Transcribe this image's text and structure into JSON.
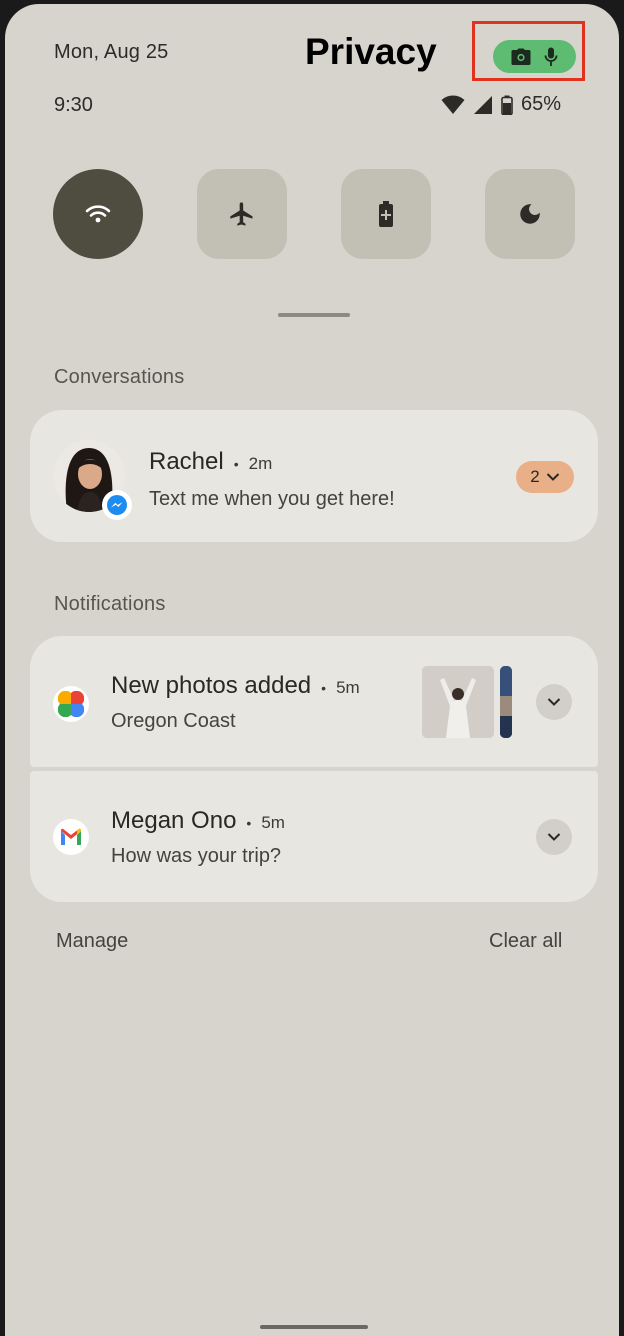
{
  "header": {
    "date": "Mon, Aug 25",
    "time": "9:30",
    "privacy_label": "Privacy",
    "battery_percent": "65%"
  },
  "privacy_indicator": {
    "icons": [
      "camera-icon",
      "microphone-icon"
    ],
    "chip_color": "#5dbb72",
    "highlight_color": "#e0321c"
  },
  "quick_settings": [
    {
      "icon": "wifi-icon",
      "active": true
    },
    {
      "icon": "airplane-icon",
      "active": false
    },
    {
      "icon": "battery-saver-icon",
      "active": false
    },
    {
      "icon": "moon-icon",
      "active": false
    }
  ],
  "conversations": {
    "heading": "Conversations",
    "items": [
      {
        "name": "Rachel",
        "ago": "2m",
        "message": "Text me when you get here!",
        "count": "2",
        "app_icon": "messenger-icon"
      }
    ]
  },
  "notifications": {
    "heading": "Notifications",
    "items": [
      {
        "title": "New photos added",
        "ago": "5m",
        "body": "Oregon Coast",
        "app_icon": "google-photos-icon"
      },
      {
        "title": "Megan Ono",
        "ago": "5m",
        "body": "How was your trip?",
        "app_icon": "gmail-icon"
      }
    ]
  },
  "footer": {
    "manage_label": "Manage",
    "clear_label": "Clear all"
  },
  "separator": "•"
}
